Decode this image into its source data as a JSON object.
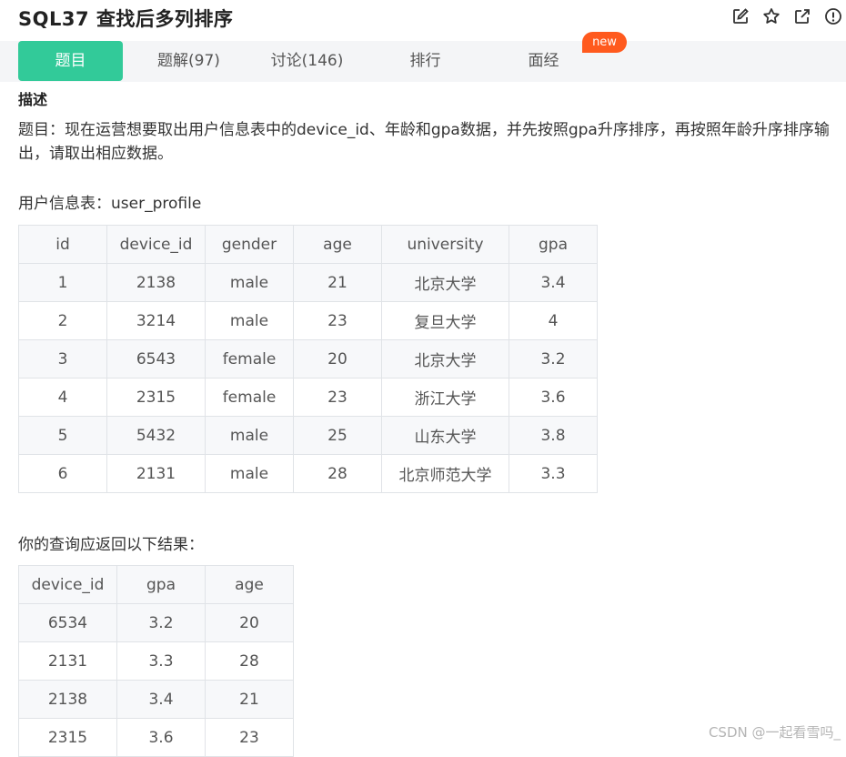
{
  "header": {
    "title": "SQL37  查找后多列排序",
    "icons": [
      "edit-icon",
      "star-icon",
      "share-icon",
      "info-icon"
    ]
  },
  "tabs": [
    {
      "label": "题目",
      "active": true
    },
    {
      "label": "题解(97)",
      "active": false
    },
    {
      "label": "讨论(146)",
      "active": false
    },
    {
      "label": "排行",
      "active": false
    },
    {
      "label": "面经",
      "active": false
    }
  ],
  "new_badge": "new",
  "content": {
    "section_heading": "描述",
    "description": "题目：现在运营想要取出用户信息表中的device_id、年龄和gpa数据，并先按照gpa升序排序，再按照年龄升序排序输出，请取出相应数据。",
    "table1_label": "用户信息表：user_profile",
    "table1": {
      "headers": [
        "id",
        "device_id",
        "gender",
        "age",
        "university",
        "gpa"
      ],
      "rows": [
        [
          "1",
          "2138",
          "male",
          "21",
          "北京大学",
          "3.4"
        ],
        [
          "2",
          "3214",
          "male",
          "23",
          "复旦大学",
          "4"
        ],
        [
          "3",
          "6543",
          "female",
          "20",
          "北京大学",
          "3.2"
        ],
        [
          "4",
          "2315",
          "female",
          "23",
          "浙江大学",
          "3.6"
        ],
        [
          "5",
          "5432",
          "male",
          "25",
          "山东大学",
          "3.8"
        ],
        [
          "6",
          "2131",
          "male",
          "28",
          "北京师范大学",
          "3.3"
        ]
      ]
    },
    "table2_label": "你的查询应返回以下结果：",
    "table2": {
      "headers": [
        "device_id",
        "gpa",
        "age"
      ],
      "rows": [
        [
          "6534",
          "3.2",
          "20"
        ],
        [
          "2131",
          "3.3",
          "28"
        ],
        [
          "2138",
          "3.4",
          "21"
        ],
        [
          "2315",
          "3.6",
          "23"
        ]
      ]
    }
  },
  "watermark": "CSDN @一起看雪吗_",
  "colors": {
    "accent": "#32ca99",
    "badge": "#ff5a1e"
  }
}
